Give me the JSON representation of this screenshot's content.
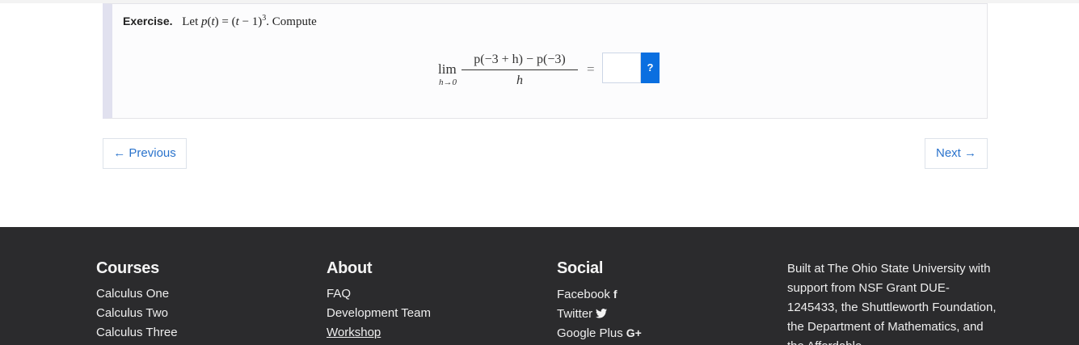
{
  "exercise": {
    "label": "Exercise.",
    "let": "Let",
    "func": "p",
    "var": "t",
    "eq_text": " = (",
    "base": "t",
    "minus_one": " − 1)",
    "exp": "3",
    "compute": ". Compute",
    "lim": "lim",
    "lim_sub": "h→0",
    "numerator": "p(−3 + h) − p(−3)",
    "denominator": "h",
    "equals": "=",
    "answer_value": "",
    "help_label": "?"
  },
  "nav": {
    "previous": "← Previous",
    "next": "Next →"
  },
  "footer": {
    "courses": {
      "heading": "Courses",
      "items": [
        "Calculus One",
        "Calculus Two",
        "Calculus Three"
      ]
    },
    "about": {
      "heading": "About",
      "items": [
        "FAQ",
        "Development Team",
        "Workshop"
      ]
    },
    "social": {
      "heading": "Social",
      "items": [
        "Facebook",
        "Twitter",
        "Google Plus"
      ]
    },
    "credits": "Built at The Ohio State University with support from NSF Grant DUE-1245433, the Shuttleworth Foundation, the Department of Mathematics, and the Affordable"
  },
  "icons": {
    "facebook": "facebook-icon",
    "twitter": "twitter-icon",
    "google_plus": "google-plus-icon"
  },
  "colors": {
    "accent": "#0a6fe0",
    "link": "#2a73cc",
    "footer_bg": "#2b2b2d"
  }
}
